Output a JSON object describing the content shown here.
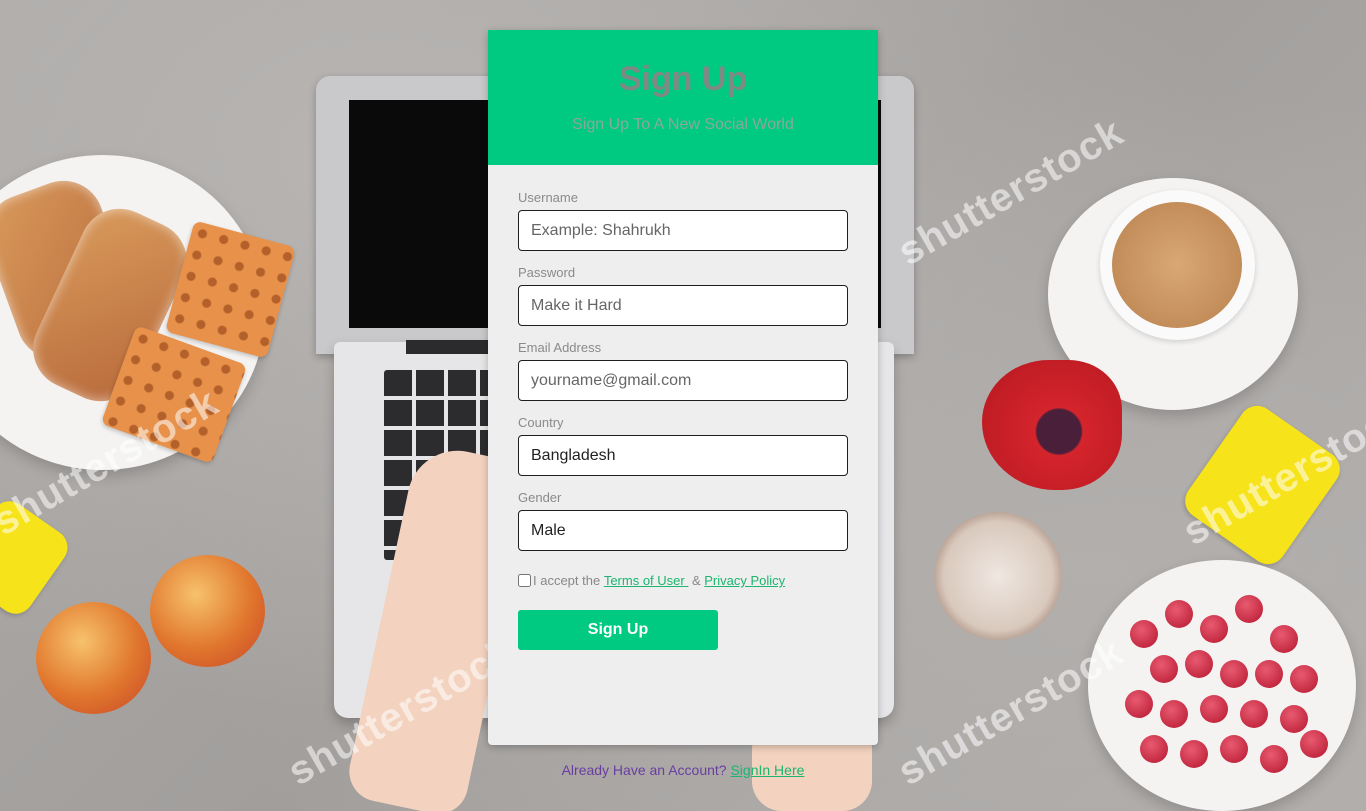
{
  "header": {
    "title": "Sign Up",
    "subtitle": "Sign Up To A New Social World"
  },
  "form": {
    "username": {
      "label": "Username",
      "placeholder": "Example: Shahrukh",
      "value": ""
    },
    "password": {
      "label": "Password",
      "placeholder": "Make it Hard",
      "value": ""
    },
    "email": {
      "label": "Email Address",
      "placeholder": "yourname@gmail.com",
      "value": ""
    },
    "country": {
      "label": "Country",
      "value": "Bangladesh"
    },
    "gender": {
      "label": "Gender",
      "value": "Male"
    },
    "terms": {
      "prefix": "I accept the ",
      "terms_link": "Terms of User ",
      "joiner": " & ",
      "privacy_link": "Privacy Policy",
      "checked": false
    },
    "submit_label": "Sign Up"
  },
  "footer": {
    "text": "Already Have an Account? ",
    "signin_link": "SignIn Here"
  },
  "watermarks": [
    "shutterstock",
    "shutterstock",
    "shutterstock",
    "shutterstock",
    "shutterstock"
  ],
  "colors": {
    "accent": "#00c982",
    "card_bg": "#eeeeee",
    "link": "#1db56f"
  }
}
